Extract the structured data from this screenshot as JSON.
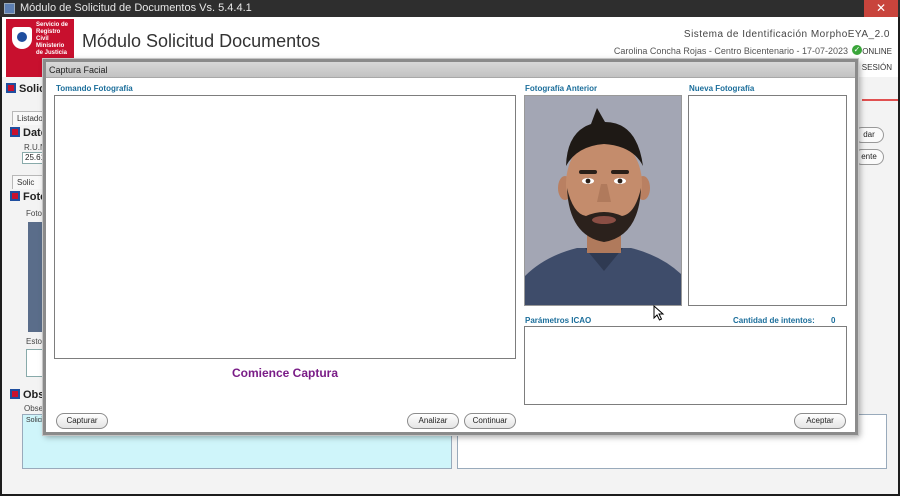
{
  "app": {
    "window_title": "Módulo de Solicitud de Documentos Vs. 5.4.4.1",
    "close_glyph": "✕",
    "logo_text": "Servicio de Registro Civil Ministerio de Justicia",
    "title": "Módulo Solicitud Documentos",
    "system_name": "Sistema de Identificación  MorphoEYA_2.0",
    "user_line": "Carolina Concha Rojas - Centro Bicentenario - 17-07-2023",
    "online_label": "ONLINE",
    "session_label": "SESIÓN"
  },
  "background": {
    "tab_listado": "Listado",
    "section_solicitud": "Solic",
    "section_datos": "Dato",
    "run_label": "R.U.N",
    "run_value": "25.61",
    "tab_solicitud": "Solic",
    "section_foto": "Foto",
    "foto_label": "Foto",
    "estado_label": "Esto",
    "section_obs": "Obse",
    "obs_label": "Obser",
    "obs_text": "Solicit Mayor RENOVACIÓN",
    "btn_right_1": "dar",
    "btn_right_2": "ente"
  },
  "modal": {
    "title": "Captura Facial",
    "capture_title": "Tomando Fotografía",
    "prev_title": "Fotografía Anterior",
    "new_title": "Nueva Fotografía",
    "icao_title": "Parámetros ICAO",
    "attempts_label": "Cantidad de intentos:",
    "attempts_value": "0",
    "status_message": "Comience Captura",
    "buttons": {
      "capture": "Capturar",
      "analyze": "Analizar",
      "continue": "Continuar",
      "accept": "Aceptar"
    }
  },
  "colors": {
    "accent_title": "#1b6e9b",
    "status_purple": "#7a1d87",
    "brand_red": "#c8102e",
    "online_green": "#3aa53a"
  }
}
